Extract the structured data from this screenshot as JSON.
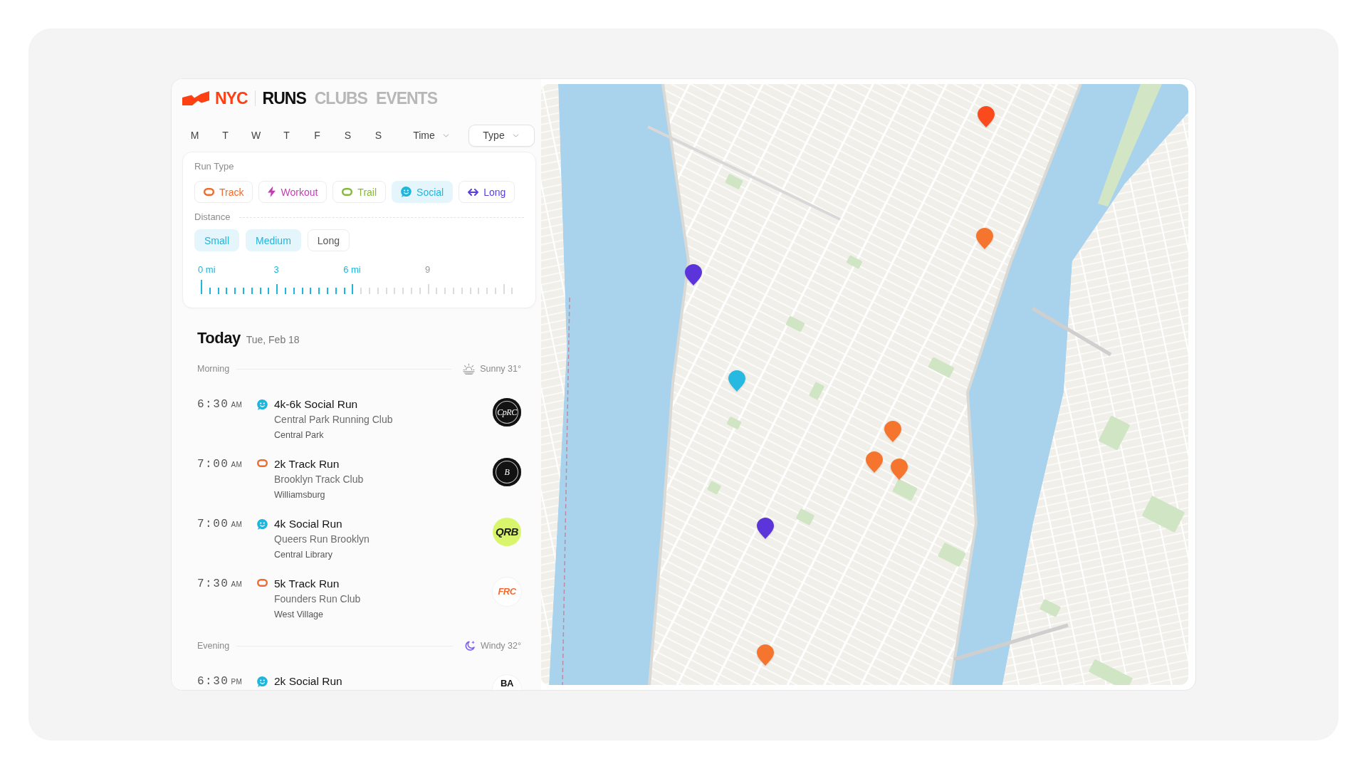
{
  "brand": {
    "city": "NYC"
  },
  "nav": [
    {
      "label": "RUNS",
      "selected": true
    },
    {
      "label": "CLUBS",
      "selected": false
    },
    {
      "label": "EVENTS",
      "selected": false
    }
  ],
  "filters": {
    "days": [
      "M",
      "T",
      "W",
      "T",
      "F",
      "S",
      "S"
    ],
    "dropdowns": [
      {
        "label": "Time",
        "expanded": false
      },
      {
        "label": "Type",
        "expanded": true
      }
    ]
  },
  "type_panel": {
    "run_type": {
      "label": "Run Type",
      "options": [
        {
          "kind": "track",
          "label": "Track",
          "selected": false
        },
        {
          "kind": "workout",
          "label": "Workout",
          "selected": false
        },
        {
          "kind": "trail",
          "label": "Trail",
          "selected": false
        },
        {
          "kind": "social",
          "label": "Social",
          "selected": true
        },
        {
          "kind": "long",
          "label": "Long",
          "selected": false
        }
      ]
    },
    "distance": {
      "label": "Distance",
      "options": [
        {
          "label": "Small",
          "selected": true
        },
        {
          "label": "Medium",
          "selected": true
        },
        {
          "label": "Long",
          "selected": false
        }
      ],
      "slider": {
        "level": 0.49,
        "labels": [
          "0 mi",
          "3",
          "6 mi",
          "9"
        ]
      }
    }
  },
  "schedule": {
    "title": "Today",
    "date": "Tue, Feb 18",
    "sections": [
      {
        "label": "Morning",
        "weather": {
          "kind": "sunny",
          "text": "Sunny 31°"
        },
        "events": [
          {
            "time": "6:30",
            "meridiem": "AM",
            "kind": "social",
            "title": "4k-6k Social Run",
            "club": "Central Park Running Club",
            "location": "Central Park",
            "logo": {
              "kind": "dark",
              "text": "CpRC"
            }
          },
          {
            "time": "7:00",
            "meridiem": "AM",
            "kind": "track",
            "title": "2k Track Run",
            "club": "Brooklyn Track Club",
            "location": "Williamsburg",
            "logo": {
              "kind": "dark",
              "text": "B"
            }
          },
          {
            "time": "7:00",
            "meridiem": "AM",
            "kind": "social",
            "title": "4k Social Run",
            "club": "Queers Run Brooklyn",
            "location": "Central Library",
            "logo": {
              "kind": "lime",
              "text": "QRB"
            }
          },
          {
            "time": "7:30",
            "meridiem": "AM",
            "kind": "track",
            "title": "5k Track Run",
            "club": "Founders Run Club",
            "location": "West Village",
            "logo": {
              "kind": "orange",
              "text": "FRC"
            }
          }
        ]
      },
      {
        "label": "Evening",
        "weather": {
          "kind": "night",
          "text": "Windy 32°"
        },
        "events": [
          {
            "time": "6:30",
            "meridiem": "PM",
            "kind": "social",
            "title": "2k Social Run",
            "logo": {
              "kind": "light",
              "text": "BA"
            }
          }
        ]
      }
    ]
  },
  "map": {
    "pins": [
      {
        "color": "#fb4a1c"
      },
      {
        "color": "#f5742e"
      },
      {
        "color": "#5b34da"
      },
      {
        "color": "#27b9e0"
      },
      {
        "color": "#f5742e"
      },
      {
        "color": "#f5742e"
      },
      {
        "color": "#f5742e"
      },
      {
        "color": "#5b34da"
      },
      {
        "color": "#f5742e"
      }
    ]
  }
}
